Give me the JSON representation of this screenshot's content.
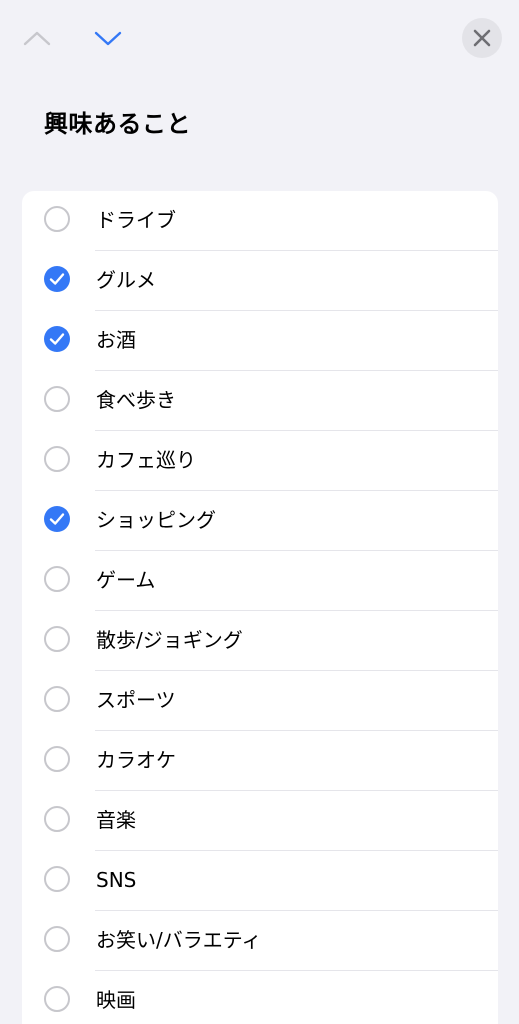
{
  "header": {
    "title": "興味あること",
    "up_icon": "chevron-up-icon",
    "down_icon": "chevron-down-icon",
    "close_icon": "close-icon"
  },
  "colors": {
    "accent": "#3478f6",
    "background": "#f2f2f7",
    "card": "#ffffff",
    "disabled": "#c7c7cc"
  },
  "interests": [
    {
      "label": "ドライブ",
      "checked": false
    },
    {
      "label": "グルメ",
      "checked": true
    },
    {
      "label": "お酒",
      "checked": true
    },
    {
      "label": "食べ歩き",
      "checked": false
    },
    {
      "label": "カフェ巡り",
      "checked": false
    },
    {
      "label": "ショッピング",
      "checked": true
    },
    {
      "label": "ゲーム",
      "checked": false
    },
    {
      "label": "散歩/ジョギング",
      "checked": false
    },
    {
      "label": "スポーツ",
      "checked": false
    },
    {
      "label": "カラオケ",
      "checked": false
    },
    {
      "label": "音楽",
      "checked": false
    },
    {
      "label": "SNS",
      "checked": false
    },
    {
      "label": "お笑い/バラエティ",
      "checked": false
    },
    {
      "label": "映画",
      "checked": false
    }
  ]
}
